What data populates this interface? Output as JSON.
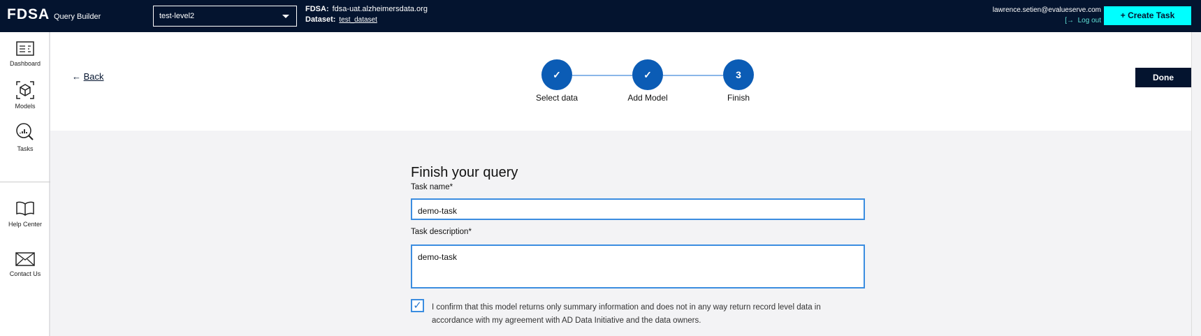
{
  "header": {
    "logo": "FDSA",
    "app_name": "Query Builder",
    "project_select": "test-level2",
    "fdsa_label": "FDSA:",
    "fdsa_value": "fdsa-uat.alzheimersdata.org",
    "dataset_label": "Dataset:",
    "dataset_value": "test_dataset",
    "user_email": "lawrence.setien@evalueserve.com",
    "logout": "Log out",
    "create_task": "+ Create Task"
  },
  "sidebar": {
    "items": [
      {
        "label": "Dashboard",
        "icon": "dashboard-icon"
      },
      {
        "label": "Models",
        "icon": "cube-icon"
      },
      {
        "label": "Tasks",
        "icon": "search-chart-icon"
      },
      {
        "label": "Help Center",
        "icon": "book-icon"
      },
      {
        "label": "Contact Us",
        "icon": "envelope-icon"
      }
    ]
  },
  "nav": {
    "back": "Back",
    "done": "Done"
  },
  "stepper": {
    "steps": [
      {
        "label": "Select data",
        "state": "complete"
      },
      {
        "label": "Add Model",
        "state": "complete"
      },
      {
        "label": "Finish",
        "number": "3",
        "state": "active"
      }
    ]
  },
  "form": {
    "title": "Finish your query",
    "task_name_label": "Task name*",
    "task_name_value": "demo-task",
    "task_description_label": "Task description*",
    "task_description_value": "demo-task",
    "confirm_checked": true,
    "confirm_text": "I confirm that this model returns only summary information and does not in any way return record level data in accordance with my agreement with AD Data Initiative and the data owners."
  },
  "colors": {
    "header_bg": "#04142f",
    "accent_cyan": "#00ffff",
    "step_blue": "#0b5cb5",
    "input_border": "#3b8de0"
  }
}
